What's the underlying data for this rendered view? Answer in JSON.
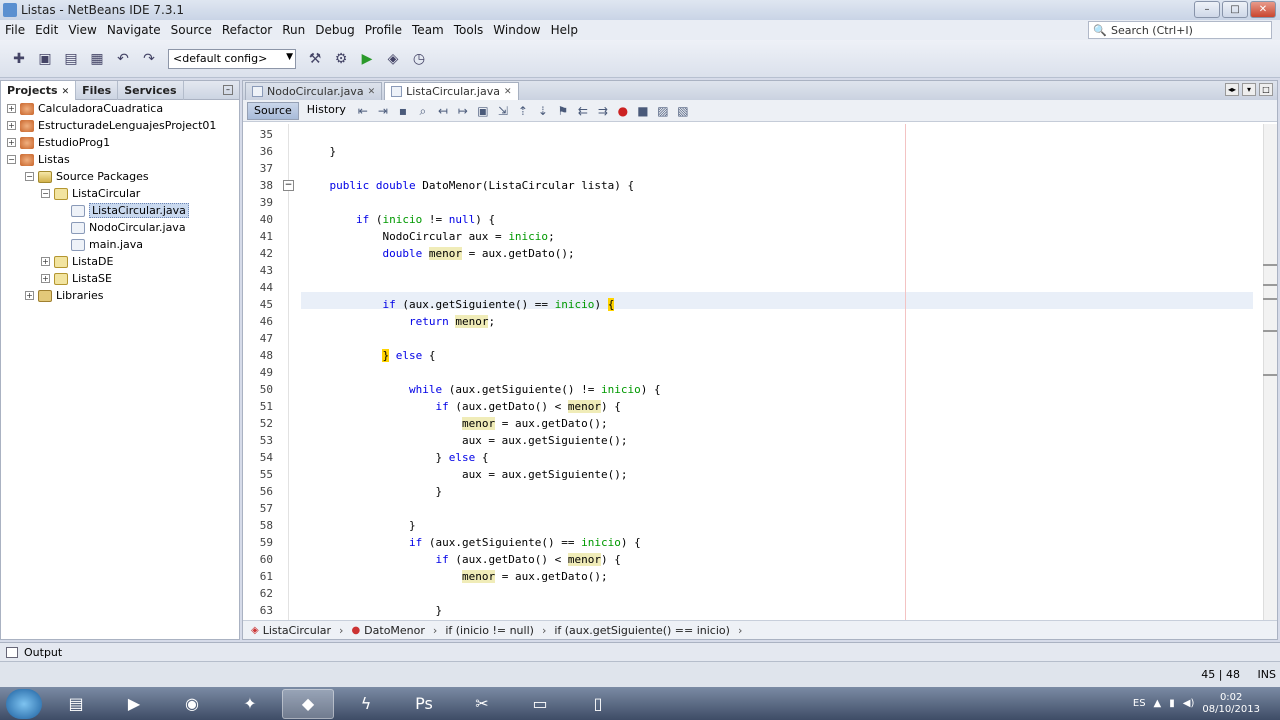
{
  "window": {
    "title": "Listas - NetBeans IDE 7.3.1"
  },
  "menu": [
    "File",
    "Edit",
    "View",
    "Navigate",
    "Source",
    "Refactor",
    "Run",
    "Debug",
    "Profile",
    "Team",
    "Tools",
    "Window",
    "Help"
  ],
  "search": {
    "placeholder": "Search (Ctrl+I)"
  },
  "toolbar": {
    "config": "<default config>"
  },
  "panel": {
    "tabs": [
      "Projects",
      "Files",
      "Services"
    ],
    "tree": [
      {
        "label": "CalculadoraCuadratica",
        "type": "proj"
      },
      {
        "label": "EstructuradeLenguajesProject01",
        "type": "proj"
      },
      {
        "label": "EstudioProg1",
        "type": "proj"
      },
      {
        "label": "Listas",
        "type": "proj"
      },
      {
        "label": "Source Packages",
        "type": "pkgs"
      },
      {
        "label": "ListaCircular",
        "type": "pkg"
      },
      {
        "label": "ListaCircular.java",
        "type": "java"
      },
      {
        "label": "NodoCircular.java",
        "type": "java"
      },
      {
        "label": "main.java",
        "type": "java"
      },
      {
        "label": "ListaDE",
        "type": "pkg"
      },
      {
        "label": "ListaSE",
        "type": "pkg"
      },
      {
        "label": "Libraries",
        "type": "lib"
      }
    ]
  },
  "editor": {
    "tabs": [
      "NodoCircular.java",
      "ListaCircular.java"
    ],
    "source_label": "Source",
    "history_label": "History",
    "lines": [
      {
        "n": "35",
        "t": ""
      },
      {
        "n": "36",
        "t": "    }"
      },
      {
        "n": "37",
        "t": ""
      },
      {
        "n": "38",
        "t": "    public double DatoMenor(ListaCircular lista) {"
      },
      {
        "n": "39",
        "t": ""
      },
      {
        "n": "40",
        "t": "        if (inicio != null) {"
      },
      {
        "n": "41",
        "t": "            NodoCircular aux = inicio;"
      },
      {
        "n": "42",
        "t": "            double menor = aux.getDato();"
      },
      {
        "n": "43",
        "t": ""
      },
      {
        "n": "44",
        "t": ""
      },
      {
        "n": "45",
        "t": "            if (aux.getSiguiente() == inicio) {"
      },
      {
        "n": "46",
        "t": "                return menor;"
      },
      {
        "n": "47",
        "t": ""
      },
      {
        "n": "48",
        "t": "            } else {"
      },
      {
        "n": "49",
        "t": ""
      },
      {
        "n": "50",
        "t": "                while (aux.getSiguiente() != inicio) {"
      },
      {
        "n": "51",
        "t": "                    if (aux.getDato() < menor) {"
      },
      {
        "n": "52",
        "t": "                        menor = aux.getDato();"
      },
      {
        "n": "53",
        "t": "                        aux = aux.getSiguiente();"
      },
      {
        "n": "54",
        "t": "                    } else {"
      },
      {
        "n": "55",
        "t": "                        aux = aux.getSiguiente();"
      },
      {
        "n": "56",
        "t": "                    }"
      },
      {
        "n": "57",
        "t": ""
      },
      {
        "n": "58",
        "t": "                }"
      },
      {
        "n": "59",
        "t": "                if (aux.getSiguiente() == inicio) {"
      },
      {
        "n": "60",
        "t": "                    if (aux.getDato() < menor) {"
      },
      {
        "n": "61",
        "t": "                        menor = aux.getDato();"
      },
      {
        "n": "62",
        "t": ""
      },
      {
        "n": "63",
        "t": "                    }"
      }
    ]
  },
  "breadcrumbs": [
    "ListaCircular",
    "DatoMenor",
    "if (inicio != null)",
    "if (aux.getSiguiente() == inicio)"
  ],
  "output": {
    "label": "Output"
  },
  "status": {
    "position": "45 | 48",
    "mode": "INS"
  },
  "taskbar": {
    "lang": "ES",
    "time": "0:02",
    "date": "08/10/2013"
  }
}
